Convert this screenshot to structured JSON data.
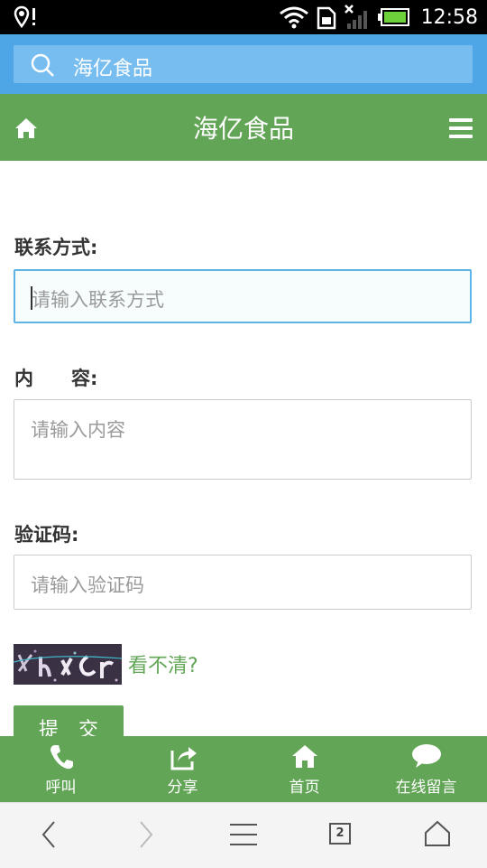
{
  "status_bar": {
    "time": "12:58"
  },
  "search": {
    "text": "海亿食品"
  },
  "header": {
    "title": "海亿食品"
  },
  "form": {
    "contact": {
      "label": "联系方式:",
      "placeholder": "请输入联系方式"
    },
    "content": {
      "label": "内　　容:",
      "placeholder": "请输入内容"
    },
    "captcha": {
      "label": "验证码:",
      "placeholder": "请输入验证码",
      "refresh_text": "看不清?"
    },
    "submit_label": "提　交"
  },
  "bottom_nav": [
    {
      "label": "呼叫",
      "icon": "phone-icon"
    },
    {
      "label": "分享",
      "icon": "share-icon"
    },
    {
      "label": "首页",
      "icon": "home-icon"
    },
    {
      "label": "在线留言",
      "icon": "chat-icon"
    }
  ],
  "browser": {
    "tab_count": "2"
  },
  "colors": {
    "accent_green": "#62a556",
    "search_blue": "#4ea6e6"
  }
}
